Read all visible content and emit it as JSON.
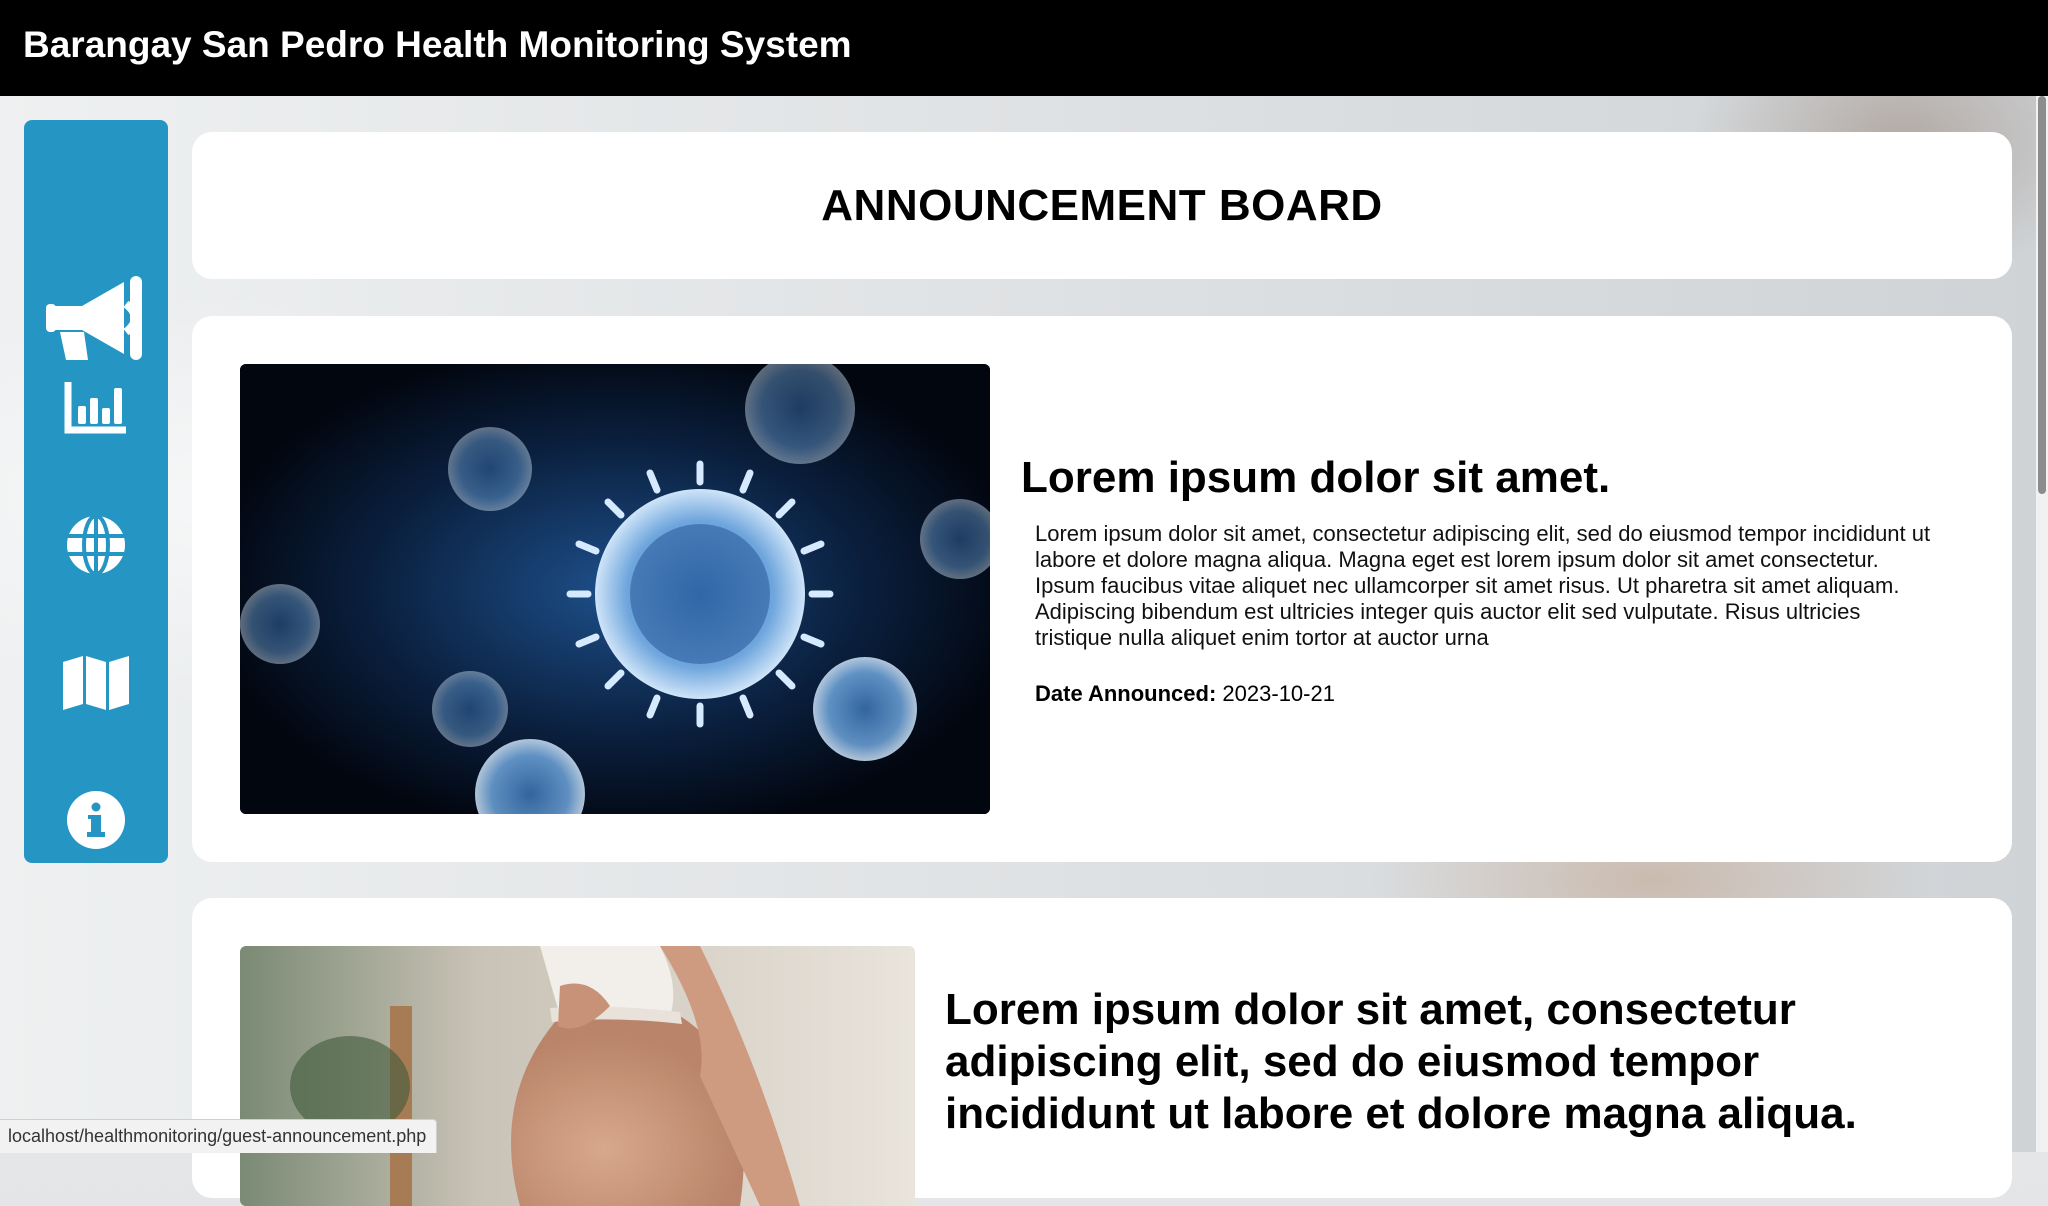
{
  "app": {
    "title": "Barangay San Pedro Health Monitoring System"
  },
  "sidebar": {
    "items": [
      {
        "name": "announcements",
        "icon": "megaphone-icon",
        "active": true
      },
      {
        "name": "statistics",
        "icon": "bar-chart-icon"
      },
      {
        "name": "web",
        "icon": "globe-icon"
      },
      {
        "name": "map",
        "icon": "map-icon"
      },
      {
        "name": "about",
        "icon": "info-icon"
      }
    ],
    "color": "#2596c4"
  },
  "board": {
    "title": "ANNOUNCEMENT BOARD"
  },
  "announcements": [
    {
      "image": "virus-image",
      "title": "Lorem ipsum dolor sit amet.",
      "body": "Lorem ipsum dolor sit amet, consectetur adipiscing elit, sed do eiusmod tempor incididunt ut labore et dolore magna aliqua. Magna eget est lorem ipsum dolor sit amet consectetur. Ipsum faucibus vitae aliquet nec ullamcorper sit amet risus. Ut pharetra sit amet aliquam. Adipiscing bibendum est ultricies integer quis auctor elit sed vulputate. Risus ultricies tristique nulla aliquet enim tortor at auctor urna",
      "date_label": "Date Announced:",
      "date": "2023-10-21"
    },
    {
      "image": "pregnant-woman-image",
      "title": "Lorem ipsum dolor sit amet, consectetur adipiscing elit, sed do eiusmod tempor incididunt ut labore et dolore magna aliqua."
    }
  ],
  "status_bar": {
    "url": "localhost/healthmonitoring/guest-announcement.php"
  }
}
